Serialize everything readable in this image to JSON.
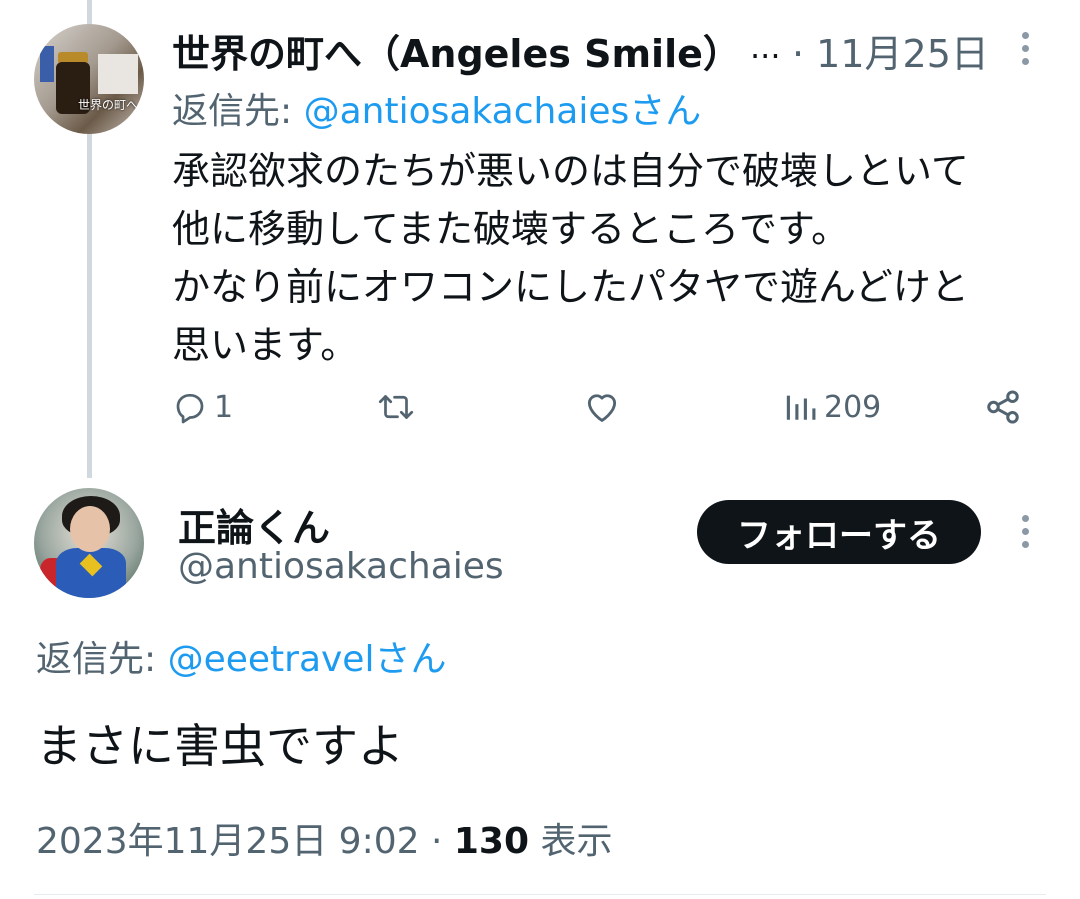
{
  "parent_tweet": {
    "author_name": "世界の町へ（Angeles Smile）",
    "truncation": "...",
    "separator_date": "· 11月25日",
    "avatar_caption": "世界の町へ",
    "reply_to_prefix": "返信先: ",
    "reply_to_mention": "@antiosakachaiesさん",
    "body_lines": [
      "承認欲求のたちが悪いのは自分で破壊しといて",
      "他に移動してまた破壊するところです。",
      "かなり前にオワコンにしたパタヤで遊んどけと",
      "思います。"
    ],
    "actions": {
      "reply_count": "1",
      "retweet_count": "",
      "like_count": "",
      "views_count": "209"
    }
  },
  "main_tweet": {
    "author_name": "正論くん",
    "handle": "@antiosakachaies",
    "follow_label": "フォローする",
    "reply_to_prefix": "返信先: ",
    "reply_to_mention": "@eeetravelさん",
    "body": "まさに害虫ですよ",
    "timestamp": "2023年11月25日 9:02 · ",
    "views_count": "130",
    "views_label": " 表示"
  },
  "icons": {
    "more": "more-vertical-icon",
    "reply": "reply-icon",
    "retweet": "retweet-icon",
    "like": "heart-icon",
    "views": "bar-chart-icon",
    "share": "share-icon"
  },
  "colors": {
    "text": "#0f1419",
    "secondary": "#536471",
    "link": "#1d9bf0",
    "thread_line": "#cfd9de",
    "follow_button": "#0f1419"
  }
}
